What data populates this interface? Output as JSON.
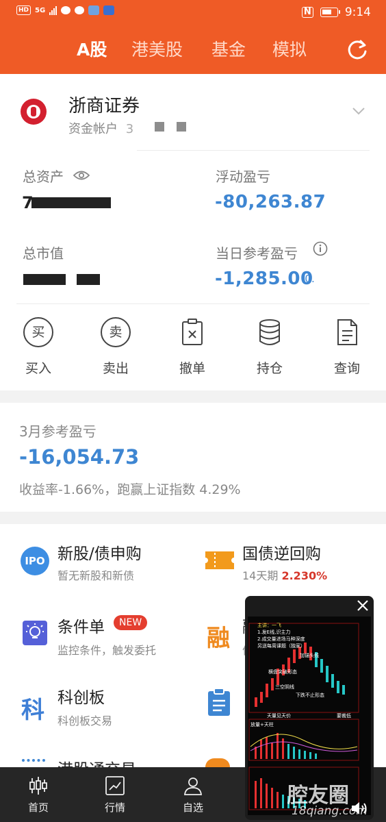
{
  "status_bar": {
    "left_label": "HD",
    "network": "5G",
    "time": "9:14"
  },
  "header": {
    "tabs": [
      "A股",
      "港美股",
      "基金",
      "模拟"
    ],
    "active_tab": "A股"
  },
  "account": {
    "broker_name": "浙商证券",
    "account_label": "资金帐户",
    "account_visible_chars": "3",
    "total_assets_label": "总资产",
    "total_assets_visible": "7",
    "floating_pl_label": "浮动盈亏",
    "floating_pl_value": "-80,263.87",
    "market_value_label": "总市值",
    "daily_ref_pl_label": "当日参考盈亏",
    "daily_ref_pl_value": "-1,285.00",
    "daily_ref_pl_pct": "-0.",
    "actions": [
      {
        "label": "买入",
        "glyph": "买"
      },
      {
        "label": "卖出",
        "glyph": "卖"
      },
      {
        "label": "撤单"
      },
      {
        "label": "持仓"
      },
      {
        "label": "查询"
      }
    ]
  },
  "monthly": {
    "title": "3月参考盈亏",
    "value": "-16,054.73",
    "summary": "收益率-1.66%，跑赢上证指数 4.29%"
  },
  "services": [
    {
      "title": "新股/债申购",
      "subtitle": "暂无新股和新债",
      "icon": "ipo-icon",
      "icon_text": "IPO"
    },
    {
      "title": "国债逆回购",
      "subtitle_prefix": "14天期",
      "rate": "2.230%",
      "icon": "ticket-icon"
    },
    {
      "title": "条件单",
      "subtitle": "监控条件，触发委托",
      "icon": "lightbulb-icon",
      "badge": "NEW"
    },
    {
      "title": "融",
      "subtitle": "信",
      "icon": "margin-icon",
      "icon_text": "融"
    },
    {
      "title": "科创板",
      "subtitle": "科创板交易",
      "icon": "star-market-icon",
      "icon_text": "科"
    },
    {
      "title": "港股通交易",
      "icon": "hk-connect-icon"
    }
  ],
  "bottom_nav": [
    {
      "label": "首页",
      "icon": "candlestick-icon"
    },
    {
      "label": "行情",
      "icon": "chart-icon"
    },
    {
      "label": "自选",
      "icon": "person-icon"
    }
  ],
  "video_overlay": {
    "caption": "主讲：一飞",
    "watermark": "腔友圈",
    "watermark_url": "18qiang.com",
    "chart_notes": [
      "1.发E线,识主力",
      "2.成交量进场马种深度",
      "另送每周课题（独家）",
      "加锚头线",
      "横盘突破形态",
      "三空阴线",
      "下跌不止形态",
      "天量见天价",
      "要裁低",
      "放量+天柱"
    ]
  },
  "colors": {
    "brand_orange": "#ef5b26",
    "loss_blue": "#3e86d2",
    "rate_red": "#d6372b",
    "nav_bg": "#262626"
  }
}
